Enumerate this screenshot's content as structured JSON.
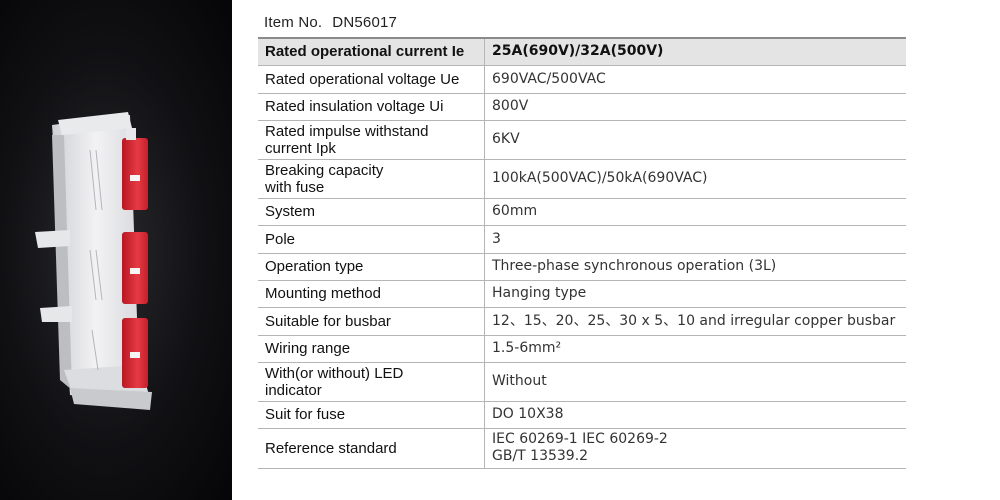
{
  "item": {
    "label": "Item No.",
    "value": "DN56017"
  },
  "specs": [
    {
      "key": "Rated operational current Ie",
      "value": "25A(690V)/32A(500V)"
    },
    {
      "key": "Rated operational voltage Ue",
      "value": "690VAC/500VAC"
    },
    {
      "key": "Rated insulation voltage Ui",
      "value": "800V"
    },
    {
      "key_line1": "Rated impulse withstand",
      "key_line2": "current Ipk",
      "value": "6KV"
    },
    {
      "key_line1": "Breaking capacity",
      "key_line2": "with fuse",
      "value": "100kA(500VAC)/50kA(690VAC)"
    },
    {
      "key": "System",
      "value": "60mm"
    },
    {
      "key": "Pole",
      "value": "3"
    },
    {
      "key": "Operation type",
      "value": "Three-phase synchronous operation (3L)"
    },
    {
      "key": "Mounting method",
      "value": "Hanging type"
    },
    {
      "key": "Suitable for busbar",
      "value": "12、15、20、25、30 x 5、10 and irregular copper busbar"
    },
    {
      "key": "Wiring range",
      "value": "1.5-6mm²"
    },
    {
      "key_line1": "With(or without) LED",
      "key_line2": "indicator",
      "value": "Without"
    },
    {
      "key": "Suit for fuse",
      "value": "DO  10X38"
    },
    {
      "key": "Reference standard",
      "value_line1": "IEC 60269-1  IEC 60269-2",
      "value_line2": "GB/T 13539.2"
    }
  ]
}
